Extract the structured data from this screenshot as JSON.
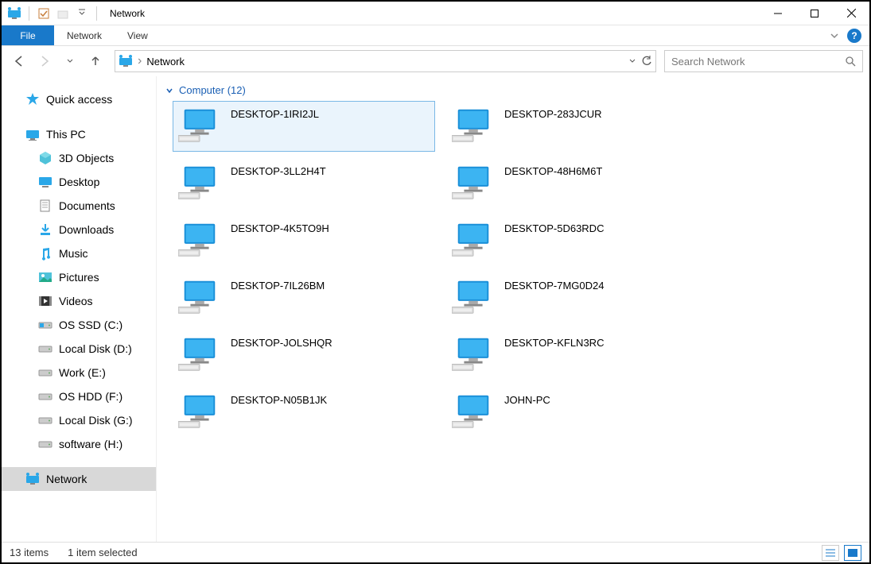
{
  "window": {
    "title": "Network"
  },
  "ribbon": {
    "file": "File",
    "tabs": [
      "Network",
      "View"
    ]
  },
  "nav": {
    "breadcrumb": "Network",
    "search_placeholder": "Search Network"
  },
  "sidebar": {
    "quick_access": "Quick access",
    "this_pc": "This PC",
    "children": [
      {
        "label": "3D Objects",
        "icon": "cube"
      },
      {
        "label": "Desktop",
        "icon": "desktop"
      },
      {
        "label": "Documents",
        "icon": "documents"
      },
      {
        "label": "Downloads",
        "icon": "downloads"
      },
      {
        "label": "Music",
        "icon": "music"
      },
      {
        "label": "Pictures",
        "icon": "pictures"
      },
      {
        "label": "Videos",
        "icon": "videos"
      },
      {
        "label": "OS SSD (C:)",
        "icon": "drive"
      },
      {
        "label": "Local Disk (D:)",
        "icon": "drive"
      },
      {
        "label": "Work (E:)",
        "icon": "drive"
      },
      {
        "label": "OS HDD (F:)",
        "icon": "drive"
      },
      {
        "label": "Local Disk (G:)",
        "icon": "drive"
      },
      {
        "label": "software (H:)",
        "icon": "drive"
      }
    ],
    "network": "Network"
  },
  "content": {
    "group_label": "Computer (12)",
    "computers": [
      "DESKTOP-1IRI2JL",
      "DESKTOP-283JCUR",
      "DESKTOP-3LL2H4T",
      "DESKTOP-48H6M6T",
      "DESKTOP-4K5TO9H",
      "DESKTOP-5D63RDC",
      "DESKTOP-7IL26BM",
      "DESKTOP-7MG0D24",
      "DESKTOP-JOLSHQR",
      "DESKTOP-KFLN3RC",
      "DESKTOP-N05B1JK",
      "JOHN-PC"
    ],
    "selected_index": 0
  },
  "status": {
    "count": "13 items",
    "selection": "1 item selected"
  }
}
